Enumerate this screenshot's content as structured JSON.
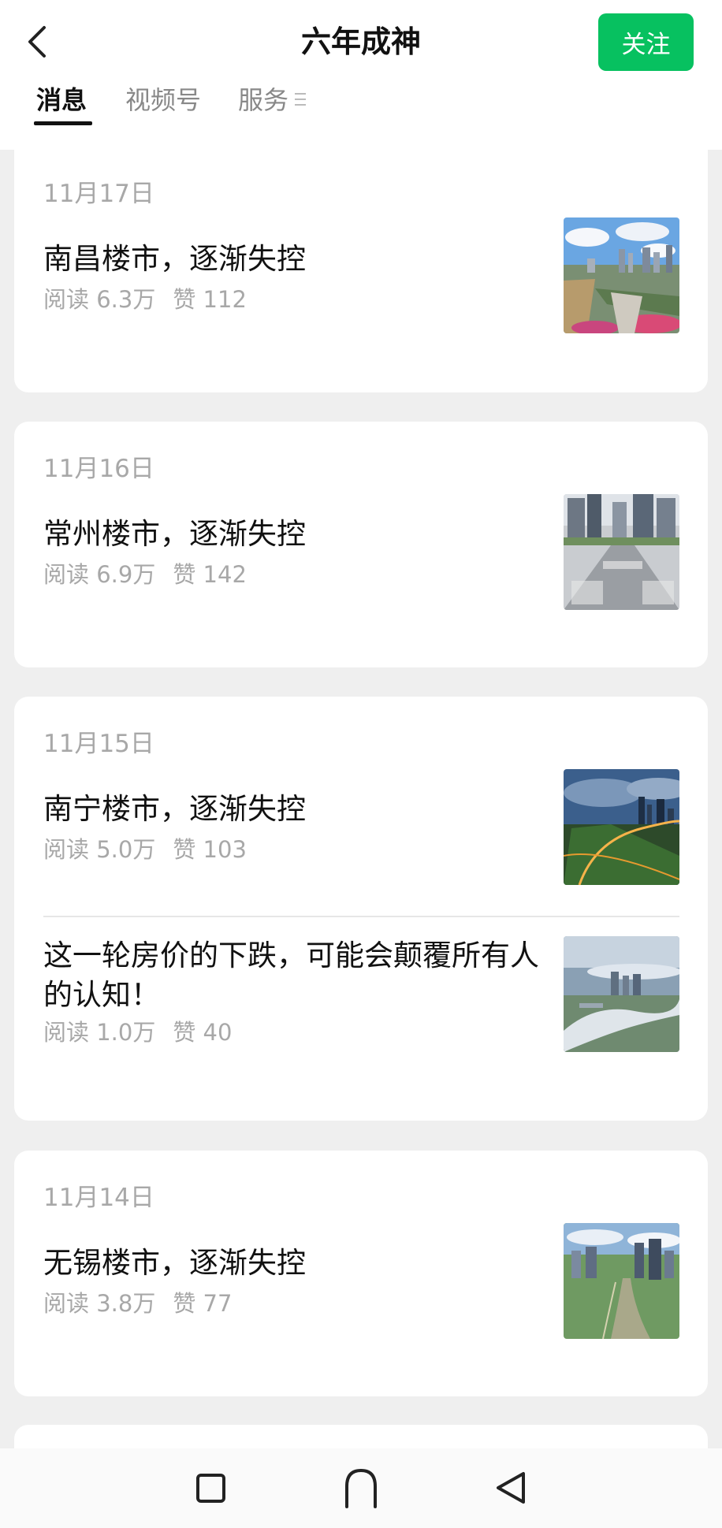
{
  "header": {
    "title": "六年成神",
    "follow_label": "关注"
  },
  "tabs": [
    {
      "label": "消息",
      "active": true
    },
    {
      "label": "视频号",
      "active": false
    },
    {
      "label": "服务",
      "active": false
    }
  ],
  "icons": {
    "back": "chevron-left-icon",
    "tab_menu": "menu-icon",
    "nav_recent": "square-icon",
    "nav_home": "arch-icon",
    "nav_back": "triangle-back-icon"
  },
  "colors": {
    "accent": "#07c160",
    "background": "#efefef",
    "card": "#ffffff",
    "meta_text": "#a8a8a8"
  },
  "feed": [
    {
      "date": "11月17日",
      "articles": [
        {
          "title": "南昌楼市，逐渐失控",
          "reads": "阅读 6.3万",
          "likes": "赞 112"
        }
      ]
    },
    {
      "date": "11月16日",
      "articles": [
        {
          "title": "常州楼市，逐渐失控",
          "reads": "阅读 6.9万",
          "likes": "赞 142"
        }
      ]
    },
    {
      "date": "11月15日",
      "articles": [
        {
          "title": "南宁楼市，逐渐失控",
          "reads": "阅读 5.0万",
          "likes": "赞 103"
        },
        {
          "title": "这一轮房价的下跌，可能会颠覆所有人的认知！",
          "reads": "阅读 1.0万",
          "likes": "赞 40"
        }
      ]
    },
    {
      "date": "11月14日",
      "articles": [
        {
          "title": "无锡楼市，逐渐失控",
          "reads": "阅读 3.8万",
          "likes": "赞 77"
        }
      ]
    }
  ]
}
